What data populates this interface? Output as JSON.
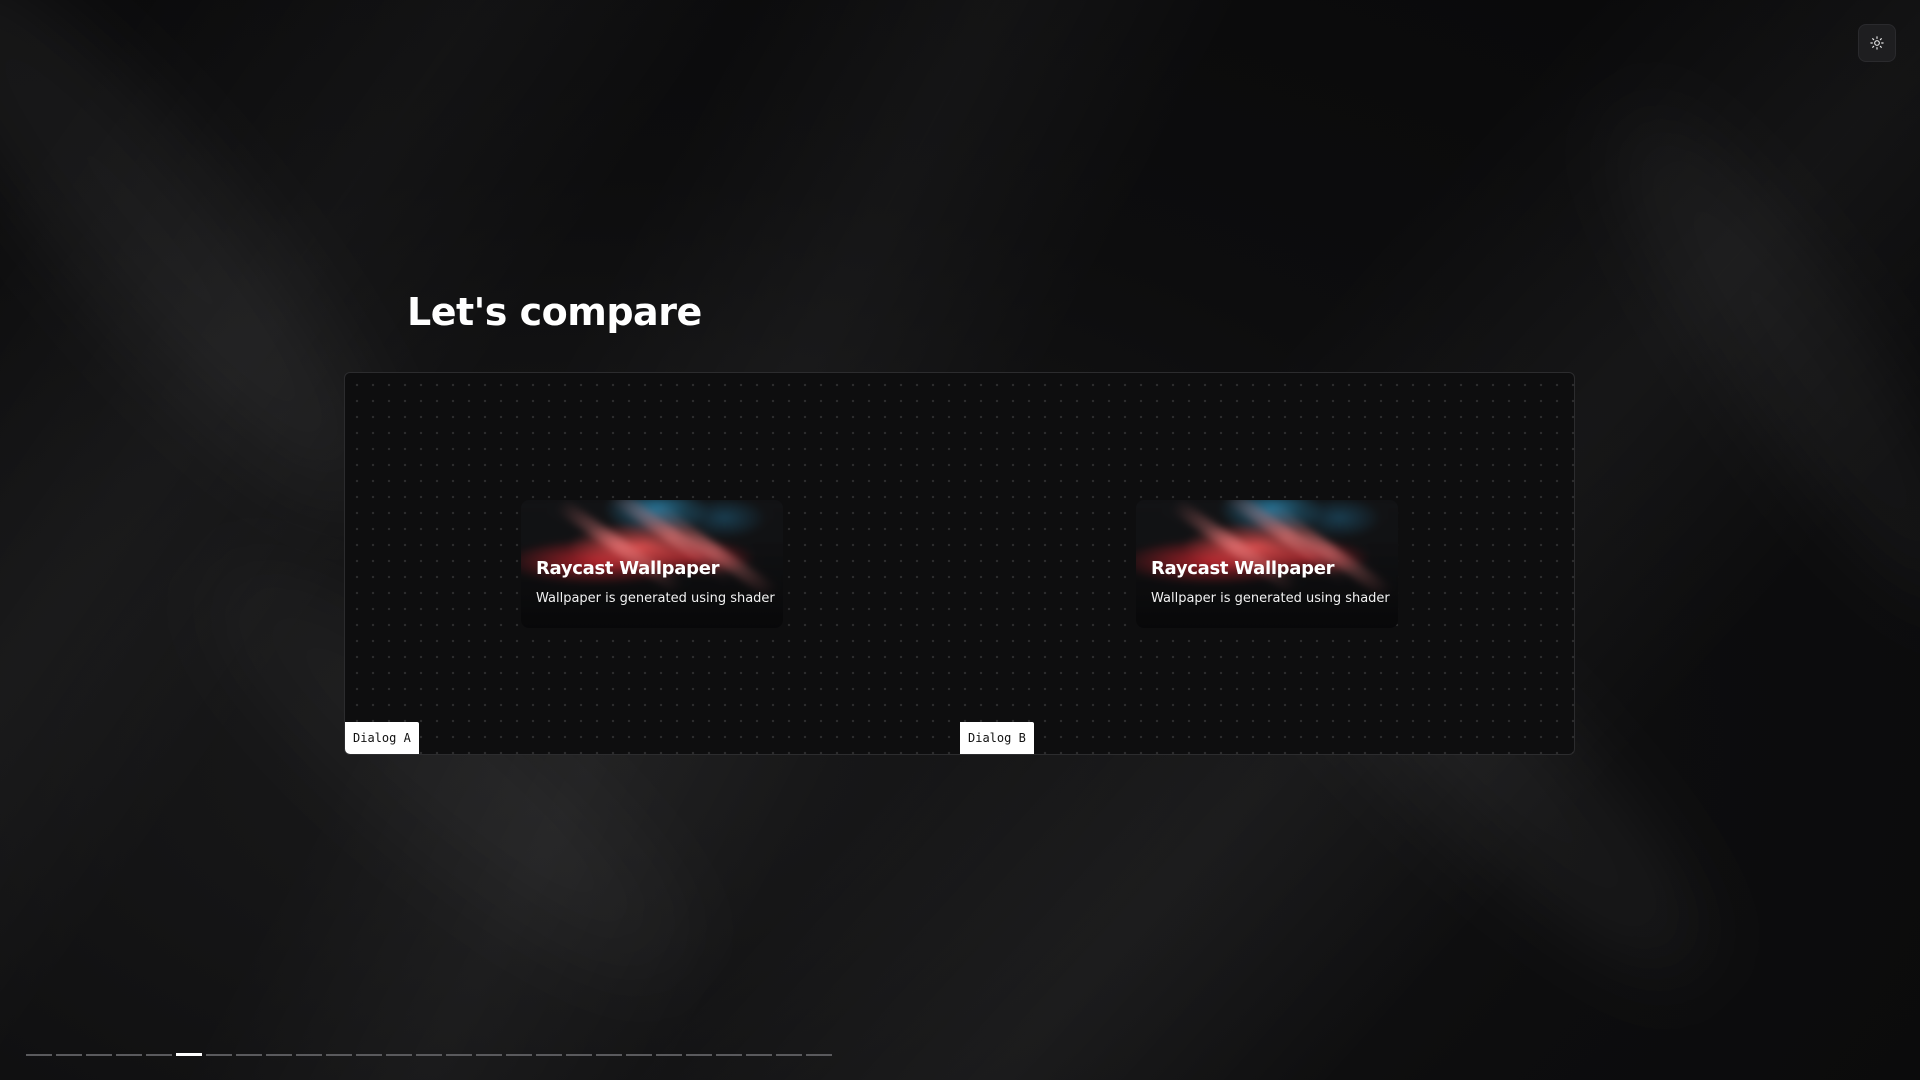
{
  "header": {
    "theme_toggle_icon": "sun-icon"
  },
  "slide": {
    "title": "Let's compare",
    "panes": [
      {
        "label": "Dialog A",
        "card": {
          "title": "Raycast Wallpaper",
          "description": "Wallpaper is generated using shader"
        }
      },
      {
        "label": "Dialog B",
        "card": {
          "title": "Raycast Wallpaper",
          "description": "Wallpaper is generated using shader"
        }
      }
    ]
  },
  "progress": {
    "total_slides": 27,
    "current_slide": 6
  },
  "colors": {
    "background": "#0b0b0c",
    "accent_red": "#dc2832",
    "accent_teal": "#2882aa",
    "label_bg": "#ffffff"
  }
}
